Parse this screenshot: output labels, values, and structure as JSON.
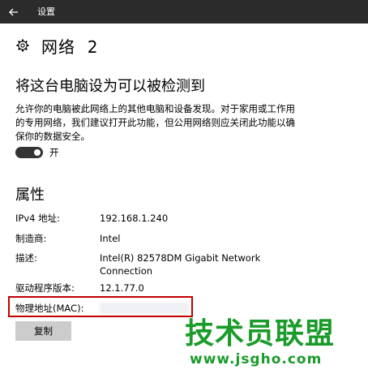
{
  "titlebar": {
    "back_icon": "arrow-left-icon",
    "title": "设置"
  },
  "header": {
    "icon": "gear-icon",
    "title": "网络  2"
  },
  "discoverable": {
    "heading": "将这台电脑设为可以被检测到",
    "description": "允许你的电脑被此网络上的其他电脑和设备发现。对于家用或工作用的专用网络，我们建议打开此功能，但公用网络则应关闭此功能以确保你的数据安全。",
    "toggle_state": "开",
    "toggle_on": true
  },
  "properties": {
    "heading": "属性",
    "items": [
      {
        "label": "IPv4 地址:",
        "value": "192.168.1.240"
      },
      {
        "label": "制造商:",
        "value": "Intel"
      },
      {
        "label": "描述:",
        "value": "Intel(R) 82578DM Gigabit Network Connection"
      },
      {
        "label": "驱动程序版本:",
        "value": "12.1.77.0"
      },
      {
        "label": "物理地址(MAC):",
        "value": ""
      }
    ],
    "copy_label": "复制"
  },
  "watermark": {
    "main": "技术员联盟",
    "url": "www.jsgho.com"
  },
  "colors": {
    "titlebar_bg": "#2b2b2b",
    "highlight_border": "#c00000",
    "watermark": "#1a9b2a",
    "button_bg": "#cccccc"
  }
}
